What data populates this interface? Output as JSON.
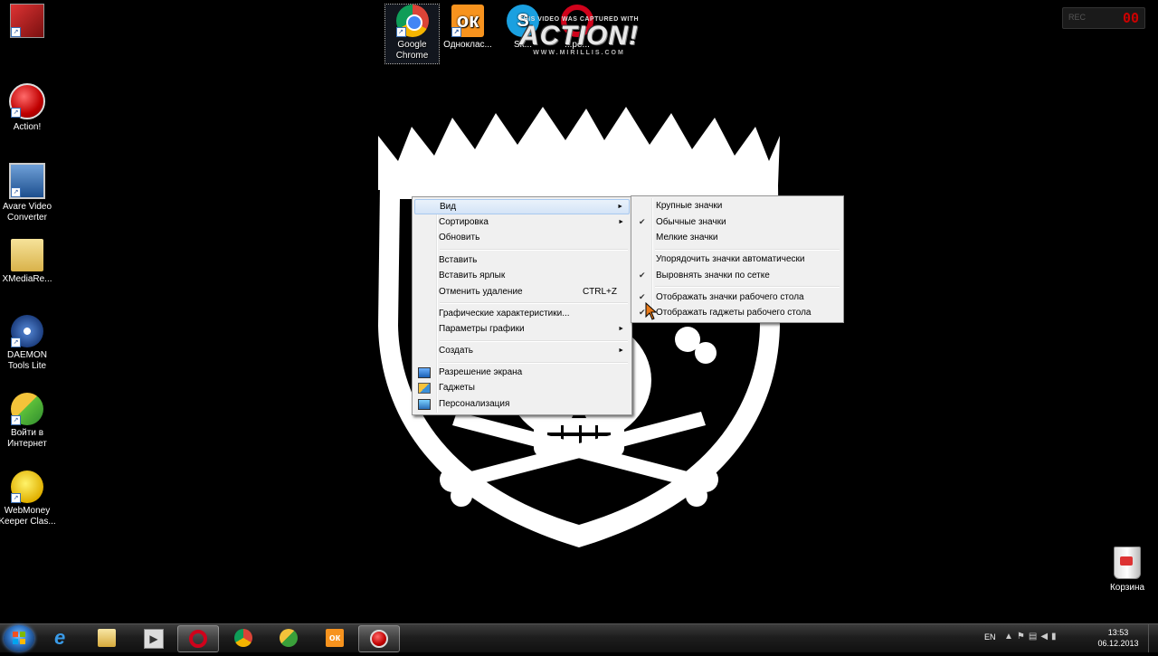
{
  "desktop_icons": [
    {
      "label": "",
      "icon": "red-app-icon"
    },
    {
      "label": "Action!",
      "icon": "action-record-icon"
    },
    {
      "label": "Avare Video Converter",
      "icon": "video-converter-icon"
    },
    {
      "label": "XMediaRe...",
      "icon": "folder-icon"
    },
    {
      "label": "DAEMON Tools Lite",
      "icon": "daemon-tools-icon"
    },
    {
      "label": "Войти в Интернет",
      "icon": "internet-globe-icon"
    },
    {
      "label": "WebMoney Keeper Clas...",
      "icon": "webmoney-icon"
    }
  ],
  "top_icons": [
    {
      "label": "Google Chrome",
      "icon": "chrome-icon"
    },
    {
      "label": "Одноклас...",
      "icon": "odnoklassniki-icon"
    },
    {
      "label": "Sk...",
      "icon": "skype-icon"
    },
    {
      "label": "...ре...",
      "icon": "opera-icon"
    }
  ],
  "watermark": {
    "top": "THIS VIDEO WAS CAPTURED WITH",
    "brand": "ACTION!",
    "url": "WWW.MIRILLIS.COM"
  },
  "recorder": {
    "label": "REC",
    "time": "00"
  },
  "context_menu": {
    "view": "Вид",
    "sort": "Сортировка",
    "refresh": "Обновить",
    "paste": "Вставить",
    "paste_shortcut": "Вставить ярлык",
    "undo_delete": "Отменить удаление",
    "undo_shortcut": "CTRL+Z",
    "graphics_props": "Графические характеристики...",
    "graphics_params": "Параметры графики",
    "create": "Создать",
    "screen_resolution": "Разрешение экрана",
    "gadgets": "Гаджеты",
    "personalize": "Персонализация"
  },
  "view_submenu": {
    "large_icons": "Крупные значки",
    "medium_icons": "Обычные значки",
    "small_icons": "Мелкие значки",
    "auto_arrange": "Упорядочить значки автоматически",
    "align_grid": "Выровнять значки по сетке",
    "show_icons": "Отображать значки рабочего стола",
    "show_gadgets": "Отображать гаджеты  рабочего стола"
  },
  "recycle_bin": {
    "label": "Корзина"
  },
  "taskbar": {
    "apps": [
      "internet-explorer-icon",
      "explorer-folder-icon",
      "media-player-icon",
      "opera-icon",
      "chrome-icon",
      "internet-globe-icon",
      "odnoklassniki-icon",
      "action-record-icon"
    ],
    "language": "EN",
    "time": "13:53",
    "date": "06.12.2013"
  },
  "colors": {
    "menu_bg": "#f0f0f0",
    "highlight": "#d4e4f7",
    "taskbar": "#1e1e1e",
    "rec_red": "#cc0000"
  }
}
